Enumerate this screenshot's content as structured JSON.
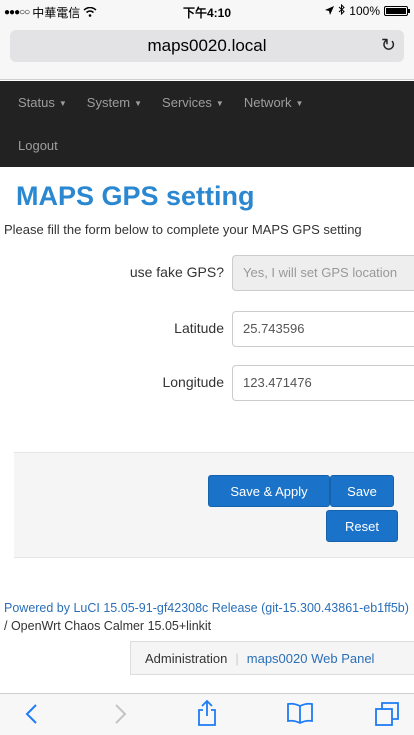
{
  "status_bar": {
    "carrier": "中華電信",
    "time": "下午4:10",
    "battery": "100%",
    "battery_level": 1.0
  },
  "browser": {
    "url": "maps0020.local"
  },
  "nav": {
    "items": [
      {
        "label": "Status"
      },
      {
        "label": "System"
      },
      {
        "label": "Services"
      },
      {
        "label": "Network"
      }
    ],
    "logout": "Logout"
  },
  "page": {
    "title": "MAPS GPS setting",
    "description": "Please fill the form below to complete your MAPS GPS setting"
  },
  "form": {
    "fake_gps_label": "use fake GPS?",
    "fake_gps_value": "Yes, I will set GPS location",
    "latitude_label": "Latitude",
    "latitude_value": "25.743596",
    "longitude_label": "Longitude",
    "longitude_value": "123.471476"
  },
  "actions": {
    "save_apply": "Save & Apply",
    "save": "Save",
    "reset": "Reset"
  },
  "footer": {
    "powered_link": "Powered by LuCI 15.05-91-gf42308c Release (git-15.300.43861-eb1ff5b)",
    "powered_suffix": " / OpenWrt Chaos Calmer 15.05+linkit",
    "crumb_admin": "Administration",
    "crumb_sep": "|",
    "crumb_panel": "maps0020 Web Panel"
  },
  "colors": {
    "accent": "#2a87d0",
    "button": "#1a73c9",
    "navbar": "#222222"
  }
}
